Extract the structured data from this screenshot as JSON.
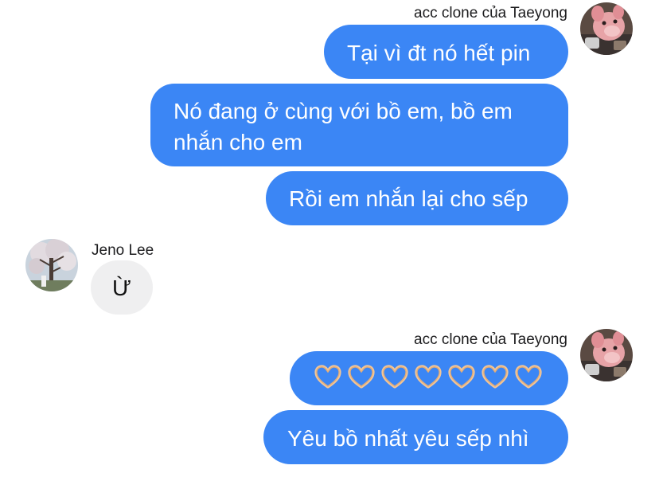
{
  "conversation": {
    "group1": {
      "sender": "acc clone của Taeyong",
      "messages": [
        "Tại vì đt nó hết pin",
        "Nó đang ở cùng với bồ em, bồ em",
        "nhắn cho em",
        "Rồi em nhắn lại cho sếp"
      ]
    },
    "group2": {
      "sender": "Jeno Lee",
      "message": "Ừ"
    },
    "group3": {
      "sender": "acc clone của Taeyong",
      "emoji": [
        "🫶",
        "🫶",
        "🫶",
        "🫶",
        "🫶",
        "🫶",
        "🫶"
      ],
      "message": "Yêu bồ nhất yêu sếp nhì"
    }
  },
  "colors": {
    "outgoing_bubble": "#3b86f5",
    "incoming_bubble": "#efeff0",
    "outgoing_text": "#ffffff",
    "incoming_text": "#111111"
  },
  "icons": {
    "taeyong_avatar": "pink-plush-toy-avatar",
    "jeno_avatar": "cherry-blossom-tree-avatar",
    "emoji": "heart-hands-emoji"
  }
}
